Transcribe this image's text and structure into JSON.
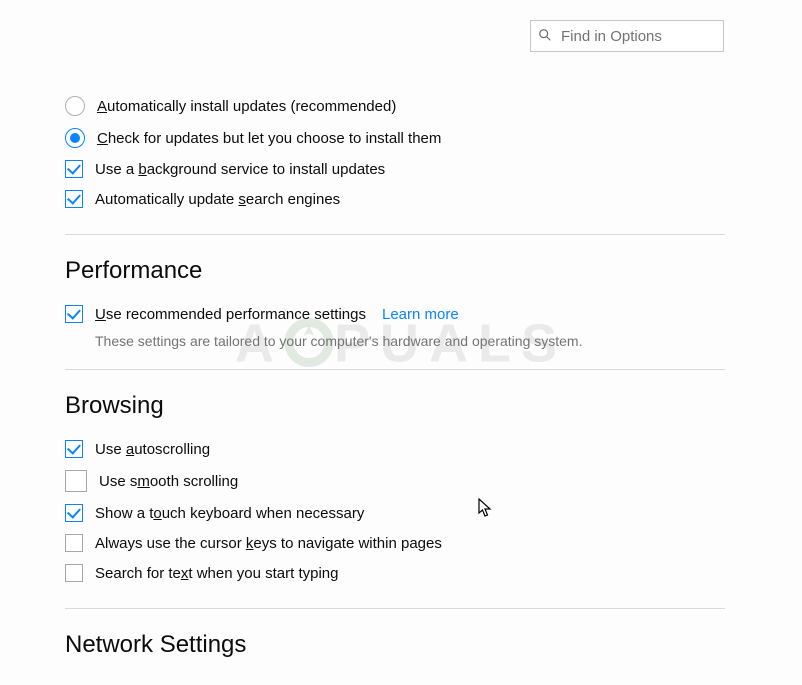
{
  "search": {
    "placeholder": "Find in Options"
  },
  "updates": {
    "radio_auto": "Automatically install updates (recommended)",
    "radio_check": "Check for updates but let you choose to install them",
    "cb_service": "Use a background service to install updates",
    "cb_search_engines": "Automatically update search engines"
  },
  "performance": {
    "title": "Performance",
    "cb_recommended": "Use recommended performance settings",
    "learn_more": "Learn more",
    "subtext": "These settings are tailored to your computer's hardware and operating system."
  },
  "browsing": {
    "title": "Browsing",
    "cb_autoscroll": "Use autoscrolling",
    "cb_smooth": "Use smooth scrolling",
    "cb_touch_kb": "Show a touch keyboard when necessary",
    "cb_cursor_keys": "Always use the cursor keys to navigate within pages",
    "cb_search_typing": "Search for text when you start typing"
  },
  "network": {
    "title": "Network Settings"
  },
  "watermark": "A  PUALS"
}
